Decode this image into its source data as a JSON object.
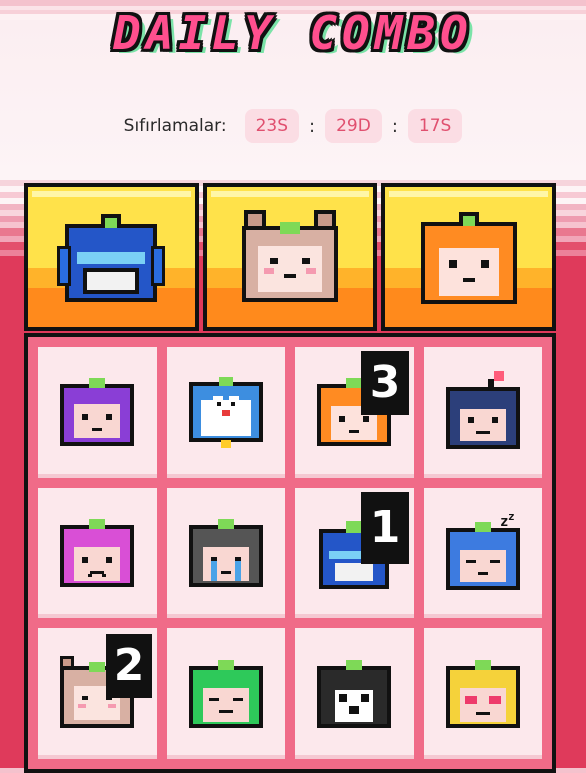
{
  "title": "DAILY COMBO",
  "timer": {
    "label": "Sıfırlamalar:",
    "hours": "23S",
    "minutes": "29D",
    "seconds": "17S",
    "separator": ":"
  },
  "featured": [
    {
      "icon": "robot-helmet-icon"
    },
    {
      "icon": "cat-hood-icon"
    },
    {
      "icon": "orange-hair-icon"
    }
  ],
  "grid": {
    "cells": [
      {
        "icon": "purple-angry-face-icon",
        "badge": ""
      },
      {
        "icon": "doraemon-face-icon",
        "badge": ""
      },
      {
        "icon": "orange-hair-face-icon",
        "badge": "3"
      },
      {
        "icon": "bomb-face-icon",
        "badge": ""
      },
      {
        "icon": "pink-sad-face-icon",
        "badge": ""
      },
      {
        "icon": "crying-face-icon",
        "badge": ""
      },
      {
        "icon": "robot-helmet-face-icon",
        "badge": "1"
      },
      {
        "icon": "sleepy-face-icon",
        "badge": ""
      },
      {
        "icon": "cat-hood-face-icon",
        "badge": "2"
      },
      {
        "icon": "green-smile-face-icon",
        "badge": ""
      },
      {
        "icon": "panda-face-icon",
        "badge": ""
      },
      {
        "icon": "heart-eyes-face-icon",
        "badge": ""
      }
    ]
  },
  "colors": {
    "accent": "#ff4f8e",
    "pill_bg": "#fbdde4",
    "pill_text": "#e0506f",
    "card_yellow": "#ffe24a",
    "grid_bg": "#f06b88"
  }
}
